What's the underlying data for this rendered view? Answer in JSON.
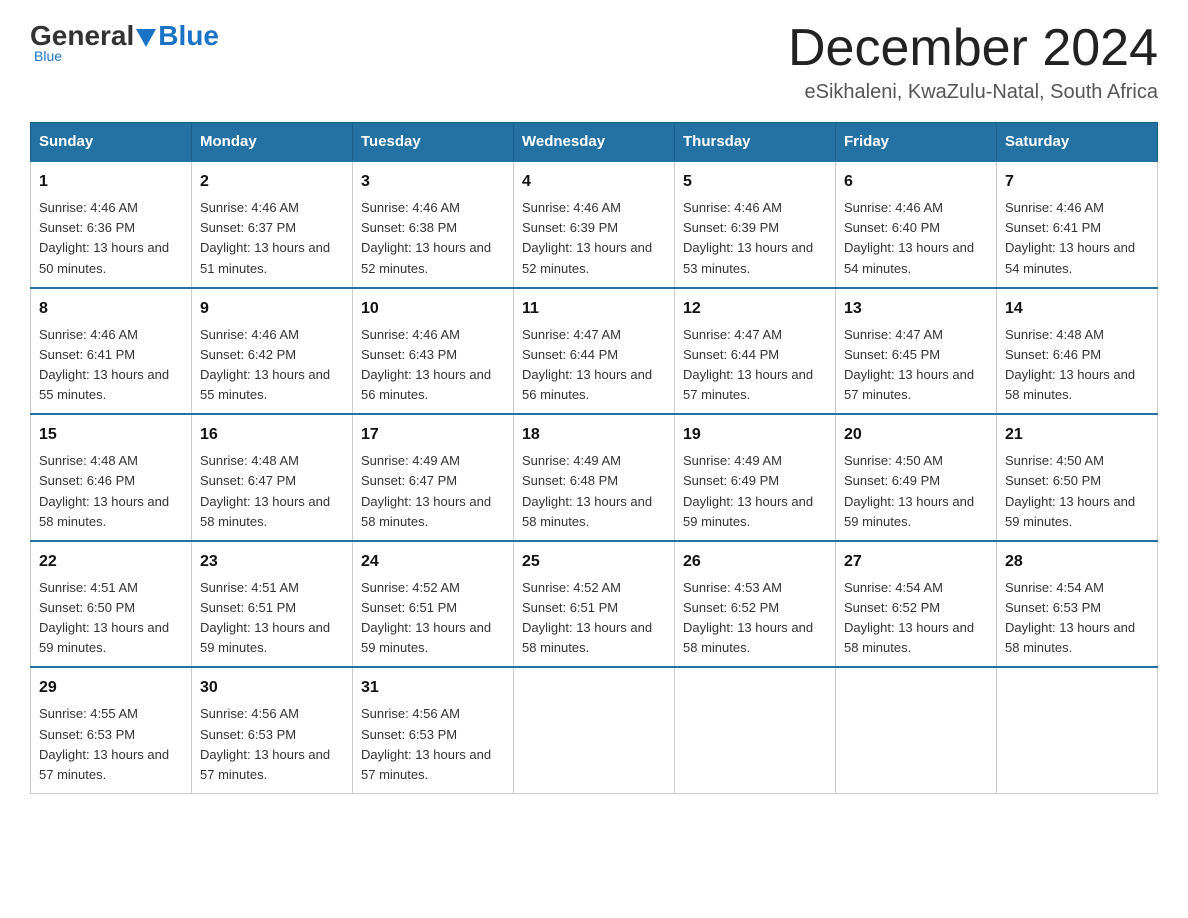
{
  "header": {
    "logo_general": "General",
    "logo_blue": "Blue",
    "title": "December 2024",
    "subtitle": "eSikhaleni, KwaZulu-Natal, South Africa"
  },
  "days_of_week": [
    "Sunday",
    "Monday",
    "Tuesday",
    "Wednesday",
    "Thursday",
    "Friday",
    "Saturday"
  ],
  "weeks": [
    [
      {
        "day": "1",
        "sunrise": "4:46 AM",
        "sunset": "6:36 PM",
        "daylight": "13 hours and 50 minutes."
      },
      {
        "day": "2",
        "sunrise": "4:46 AM",
        "sunset": "6:37 PM",
        "daylight": "13 hours and 51 minutes."
      },
      {
        "day": "3",
        "sunrise": "4:46 AM",
        "sunset": "6:38 PM",
        "daylight": "13 hours and 52 minutes."
      },
      {
        "day": "4",
        "sunrise": "4:46 AM",
        "sunset": "6:39 PM",
        "daylight": "13 hours and 52 minutes."
      },
      {
        "day": "5",
        "sunrise": "4:46 AM",
        "sunset": "6:39 PM",
        "daylight": "13 hours and 53 minutes."
      },
      {
        "day": "6",
        "sunrise": "4:46 AM",
        "sunset": "6:40 PM",
        "daylight": "13 hours and 54 minutes."
      },
      {
        "day": "7",
        "sunrise": "4:46 AM",
        "sunset": "6:41 PM",
        "daylight": "13 hours and 54 minutes."
      }
    ],
    [
      {
        "day": "8",
        "sunrise": "4:46 AM",
        "sunset": "6:41 PM",
        "daylight": "13 hours and 55 minutes."
      },
      {
        "day": "9",
        "sunrise": "4:46 AM",
        "sunset": "6:42 PM",
        "daylight": "13 hours and 55 minutes."
      },
      {
        "day": "10",
        "sunrise": "4:46 AM",
        "sunset": "6:43 PM",
        "daylight": "13 hours and 56 minutes."
      },
      {
        "day": "11",
        "sunrise": "4:47 AM",
        "sunset": "6:44 PM",
        "daylight": "13 hours and 56 minutes."
      },
      {
        "day": "12",
        "sunrise": "4:47 AM",
        "sunset": "6:44 PM",
        "daylight": "13 hours and 57 minutes."
      },
      {
        "day": "13",
        "sunrise": "4:47 AM",
        "sunset": "6:45 PM",
        "daylight": "13 hours and 57 minutes."
      },
      {
        "day": "14",
        "sunrise": "4:48 AM",
        "sunset": "6:46 PM",
        "daylight": "13 hours and 58 minutes."
      }
    ],
    [
      {
        "day": "15",
        "sunrise": "4:48 AM",
        "sunset": "6:46 PM",
        "daylight": "13 hours and 58 minutes."
      },
      {
        "day": "16",
        "sunrise": "4:48 AM",
        "sunset": "6:47 PM",
        "daylight": "13 hours and 58 minutes."
      },
      {
        "day": "17",
        "sunrise": "4:49 AM",
        "sunset": "6:47 PM",
        "daylight": "13 hours and 58 minutes."
      },
      {
        "day": "18",
        "sunrise": "4:49 AM",
        "sunset": "6:48 PM",
        "daylight": "13 hours and 58 minutes."
      },
      {
        "day": "19",
        "sunrise": "4:49 AM",
        "sunset": "6:49 PM",
        "daylight": "13 hours and 59 minutes."
      },
      {
        "day": "20",
        "sunrise": "4:50 AM",
        "sunset": "6:49 PM",
        "daylight": "13 hours and 59 minutes."
      },
      {
        "day": "21",
        "sunrise": "4:50 AM",
        "sunset": "6:50 PM",
        "daylight": "13 hours and 59 minutes."
      }
    ],
    [
      {
        "day": "22",
        "sunrise": "4:51 AM",
        "sunset": "6:50 PM",
        "daylight": "13 hours and 59 minutes."
      },
      {
        "day": "23",
        "sunrise": "4:51 AM",
        "sunset": "6:51 PM",
        "daylight": "13 hours and 59 minutes."
      },
      {
        "day": "24",
        "sunrise": "4:52 AM",
        "sunset": "6:51 PM",
        "daylight": "13 hours and 59 minutes."
      },
      {
        "day": "25",
        "sunrise": "4:52 AM",
        "sunset": "6:51 PM",
        "daylight": "13 hours and 58 minutes."
      },
      {
        "day": "26",
        "sunrise": "4:53 AM",
        "sunset": "6:52 PM",
        "daylight": "13 hours and 58 minutes."
      },
      {
        "day": "27",
        "sunrise": "4:54 AM",
        "sunset": "6:52 PM",
        "daylight": "13 hours and 58 minutes."
      },
      {
        "day": "28",
        "sunrise": "4:54 AM",
        "sunset": "6:53 PM",
        "daylight": "13 hours and 58 minutes."
      }
    ],
    [
      {
        "day": "29",
        "sunrise": "4:55 AM",
        "sunset": "6:53 PM",
        "daylight": "13 hours and 57 minutes."
      },
      {
        "day": "30",
        "sunrise": "4:56 AM",
        "sunset": "6:53 PM",
        "daylight": "13 hours and 57 minutes."
      },
      {
        "day": "31",
        "sunrise": "4:56 AM",
        "sunset": "6:53 PM",
        "daylight": "13 hours and 57 minutes."
      },
      null,
      null,
      null,
      null
    ]
  ]
}
